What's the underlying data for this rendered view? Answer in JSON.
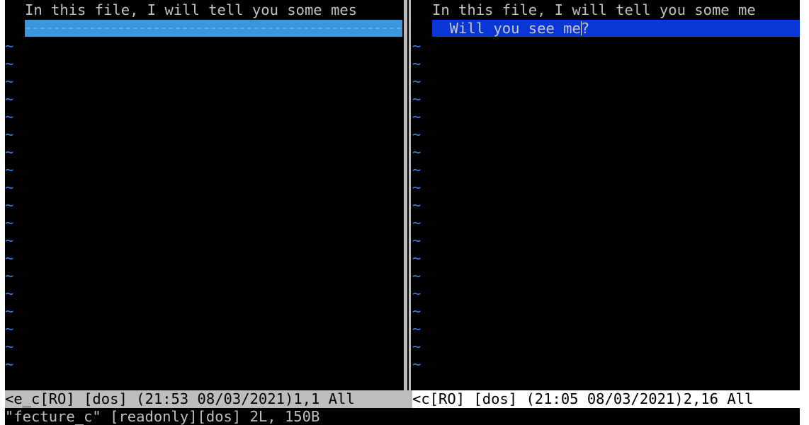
{
  "left_pane": {
    "first_line": "In this file, I will tell you some mes",
    "tilde": "~",
    "status": "<e_c[RO] [dos] (21:53 08/03/2021)1,1 All"
  },
  "right_pane": {
    "first_line": "In this file, I will tell you some me",
    "added_line": "  Will you see me?",
    "tilde": "~",
    "status": "<c[RO] [dos] (21:05 08/03/2021)2,16 All"
  },
  "command_line": "\"fecture_c\" [readonly][dos] 2L, 150B",
  "colors": {
    "tilde": "#3b7de6",
    "diff_delete": "#3a96dd",
    "diff_add": "#0a36d8",
    "status_inactive": "#bdbdbd",
    "status_active": "#ffffff"
  }
}
